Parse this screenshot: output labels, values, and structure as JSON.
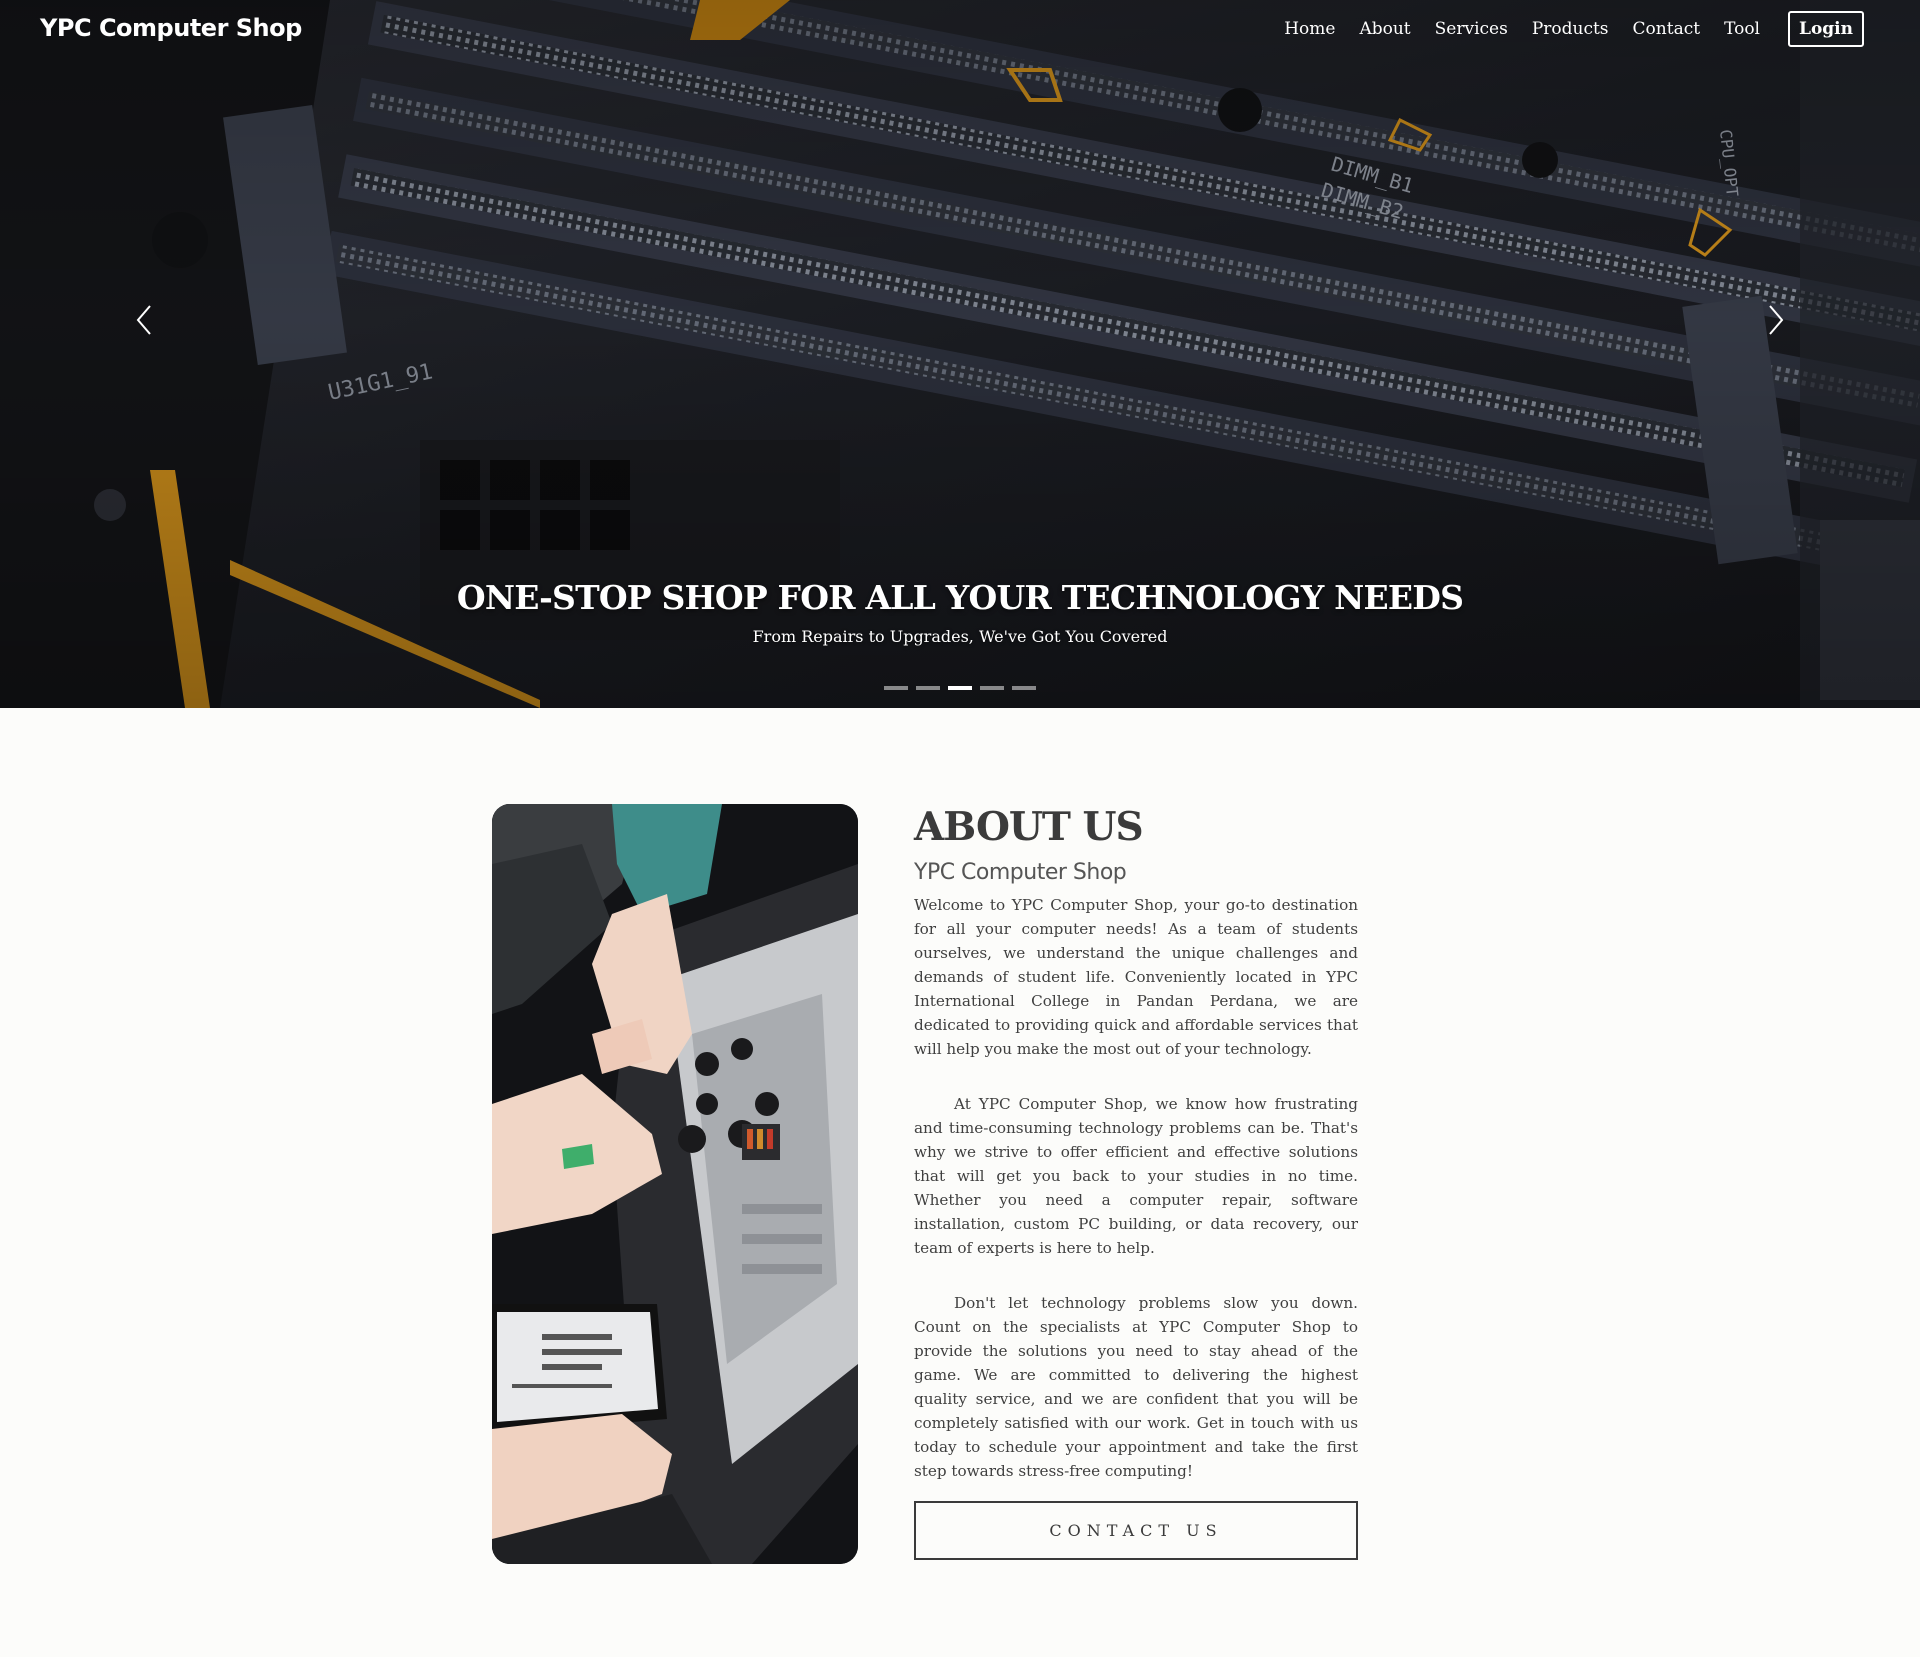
{
  "brand": "YPC Computer Shop",
  "nav": {
    "links": [
      "Home",
      "About",
      "Services",
      "Products",
      "Contact",
      "Tool"
    ],
    "login_label": "Login"
  },
  "hero": {
    "title": "ONE-STOP SHOP FOR ALL YOUR TECHNOLOGY NEEDS",
    "subtitle": "From Repairs to Upgrades, We've Got You Covered",
    "slide_count": 5,
    "active_slide": 3,
    "prev_icon": "chevron-left-icon",
    "next_icon": "chevron-right-icon"
  },
  "about": {
    "title": "ABOUT US",
    "subtitle": "YPC Computer Shop",
    "paragraphs": [
      "Welcome to YPC Computer Shop, your go-to destination for all your computer needs! As a team of students ourselves, we understand the unique challenges and demands of student life. Conveniently located in YPC International College in Pandan Perdana, we are dedicated to providing quick and affordable services that will help you make the most out of your technology.",
      "At YPC Computer Shop, we know how frustrating and time-consuming technology problems can be. That's why we strive to offer efficient and effective solutions that will get you back to your studies in no time. Whether you need a computer repair, software installation, custom PC building, or data recovery, our team of experts is here to help.",
      "Don't let technology problems slow you down. Count on the specialists at YPC Computer Shop to provide the solutions you need to stay ahead of the game. We are committed to delivering the highest quality service, and we are confident that you will be completely satisfied with our work. Get in touch with us today to schedule your appointment and take the first step towards stress-free computing!"
    ],
    "button_label": "CONTACT US"
  },
  "colors": {
    "page_bg": "#fcfcfa",
    "hero_accent": "#d9961c",
    "text": "#3a3a3a"
  }
}
